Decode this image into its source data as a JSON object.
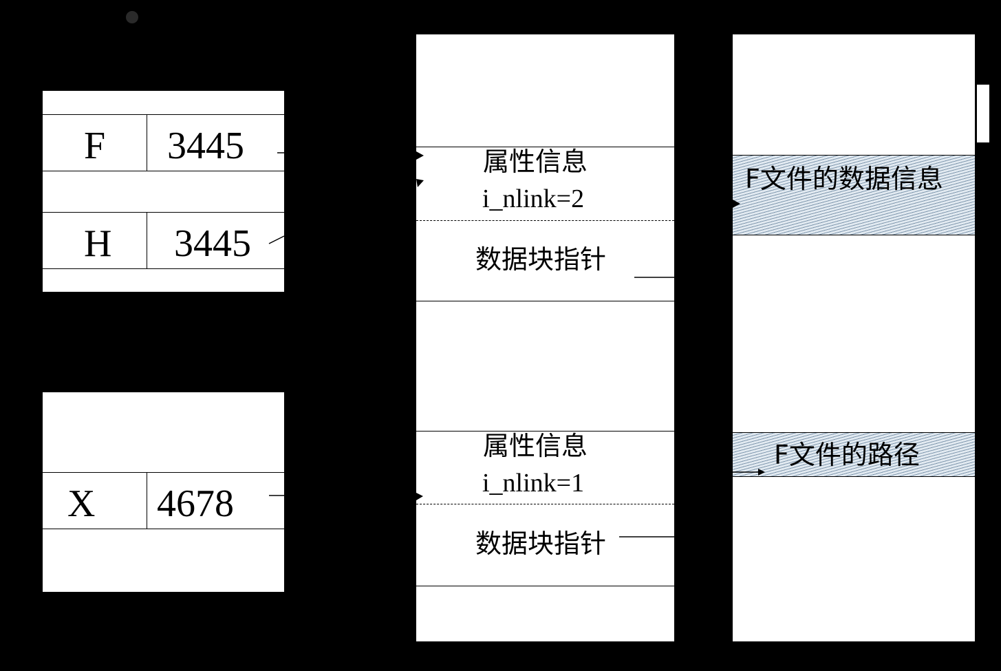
{
  "directory_tables": [
    {
      "entries": [
        {
          "name": "F",
          "inode": "3445"
        },
        {
          "name": "H",
          "inode": "3445"
        }
      ]
    },
    {
      "entries": [
        {
          "name": "X",
          "inode": "4678"
        }
      ]
    }
  ],
  "inode_table": {
    "inodes": [
      {
        "attr_label": "属性信息",
        "link_count": "i_nlink=2",
        "pointer_label": "数据块指针"
      },
      {
        "attr_label": "属性信息",
        "link_count": "i_nlink=1",
        "pointer_label": "数据块指针"
      }
    ]
  },
  "data_blocks": {
    "blocks": [
      {
        "label": "F文件的数据信息"
      },
      {
        "label": "F文件的路径"
      }
    ]
  }
}
